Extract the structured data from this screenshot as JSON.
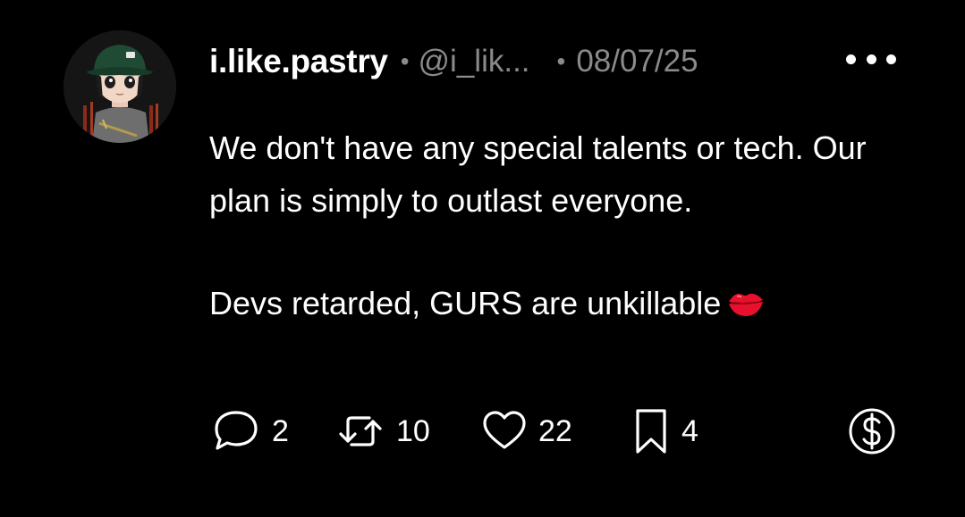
{
  "post": {
    "author": {
      "display_name": "i.like.pastry",
      "handle": "@i_lik...",
      "separator": "•"
    },
    "date": "08/07/25",
    "text_paragraphs": [
      "We don't have any special talents or tech. Our plan is simply to outlast everyone.",
      "Devs retarded, GURS are unkillable"
    ],
    "trailing_emoji": "kiss-mark-icon",
    "stats": {
      "replies": "2",
      "reposts": "10",
      "likes": "22",
      "bookmarks": "4"
    }
  },
  "colors": {
    "background": "#000000",
    "primary_text": "#ffffff",
    "secondary_text": "#8a8a8a",
    "emoji_red": "#e8112d"
  }
}
